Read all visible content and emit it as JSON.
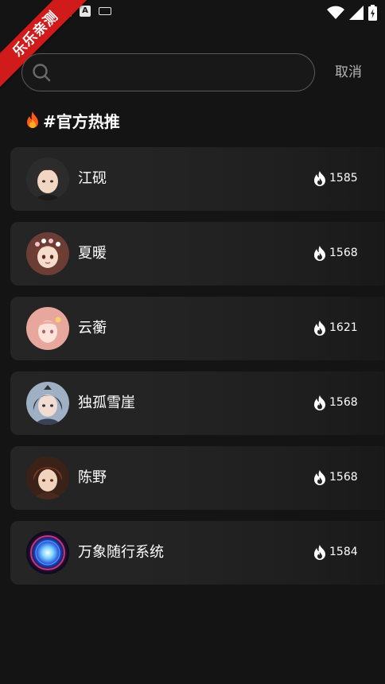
{
  "watermark": "乐乐亲测",
  "search": {
    "placeholder": "",
    "value": "",
    "cancel_label": "取消"
  },
  "section": {
    "title": "#官方热推"
  },
  "colors": {
    "background": "#141414",
    "card": "#232323",
    "ribbon": "#d11a1a",
    "fire": "#ff6a1a"
  },
  "characters": [
    {
      "name": "江砚",
      "heat": "1585",
      "avatar": "young-man-dark-hair-avatar"
    },
    {
      "name": "夏暖",
      "heat": "1568",
      "avatar": "girl-brown-hair-flower-crown-avatar"
    },
    {
      "name": "云蘅",
      "heat": "1621",
      "avatar": "girl-pink-hair-avatar"
    },
    {
      "name": "独孤雪崖",
      "heat": "1568",
      "avatar": "swordsman-dark-hair-avatar"
    },
    {
      "name": "陈野",
      "heat": "1568",
      "avatar": "young-man-red-brown-hair-avatar"
    },
    {
      "name": "万象随行系统",
      "heat": "1584",
      "avatar": "glowing-blue-orb-avatar"
    }
  ]
}
